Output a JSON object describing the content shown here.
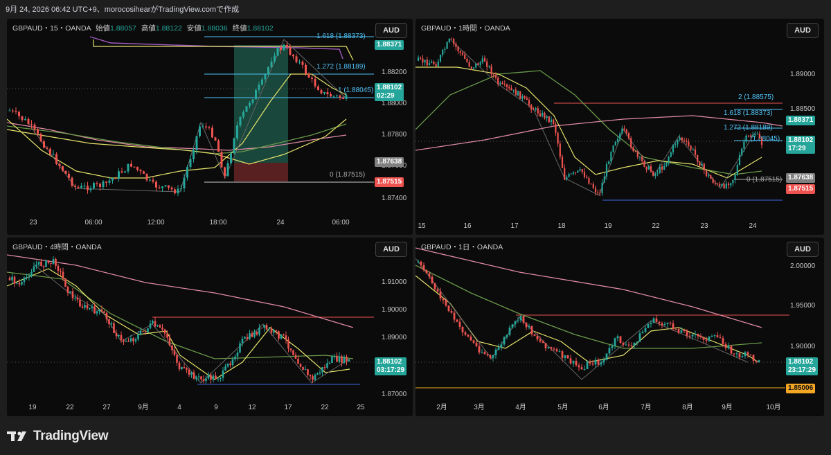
{
  "header": {
    "text": "9月 24, 2026 06:42 UTC+9、morocosihearがTradingView.comで作成"
  },
  "footer": {
    "brand": "TradingView"
  },
  "colors": {
    "up": "#26a69a",
    "down": "#ef5350",
    "bg": "#0b0b0b",
    "ma_yellow": "#e6e36a",
    "ma_green": "#6a9a4a",
    "ma_pink": "#e08aa5",
    "ma_purple": "#a05ac0"
  },
  "panels": {
    "m15": {
      "title_prefix": "GBPAUD・15・OANDA",
      "o_label": "始値",
      "o": "1.88057",
      "h_label": "高値",
      "h": "1.88122",
      "l_label": "安値",
      "l": "1.88036",
      "c_label": "終値",
      "c": "1.88102",
      "currency": "AUD",
      "price_ticks": [
        "1.88200",
        "1.88000",
        "1.87800",
        "1.87600",
        "1.87400"
      ],
      "time_ticks": [
        "23",
        "06:00",
        "12:00",
        "18:00",
        "24",
        "06:00"
      ],
      "fib": [
        "1.618 (1.88373)",
        "1.272 (1.88189)",
        "1 (1.88045)",
        "0 (1.87515)"
      ],
      "labels": {
        "a": "1.88371",
        "b": "1.88102",
        "b_sub": "02:29",
        "c": "1.87638",
        "d": "1.87515"
      }
    },
    "h1": {
      "title": "GBPAUD・1時間・OANDA",
      "currency": "AUD",
      "price_ticks": [
        "1.89000",
        "1.88500"
      ],
      "time_ticks": [
        "15",
        "16",
        "17",
        "18",
        "19",
        "22",
        "23",
        "24"
      ],
      "fib": [
        "2 (1.88575)",
        "1.618 (1.88373)",
        "1.272 (1.88189)",
        "1 (1.88045)",
        "0 (1.87515)"
      ],
      "labels": {
        "a": "1.88371",
        "b": "1.88102",
        "b_sub": "17:29",
        "c": "1.87638",
        "d": "1.87515"
      }
    },
    "h4": {
      "title": "GBPAUD・4時間・OANDA",
      "currency": "AUD",
      "price_ticks": [
        "1.91000",
        "1.90000",
        "1.89000",
        "1.87000"
      ],
      "time_ticks": [
        "19",
        "22",
        "27",
        "9月",
        "4",
        "9",
        "12",
        "17",
        "22",
        "25"
      ],
      "labels": {
        "b": "1.88102",
        "b_sub": "03:17:29"
      }
    },
    "d1": {
      "title": "GBPAUD・1日・OANDA",
      "currency": "AUD",
      "price_ticks": [
        "2.00000",
        "1.95000",
        "1.90000"
      ],
      "time_ticks": [
        "2月",
        "3月",
        "4月",
        "5月",
        "6月",
        "7月",
        "8月",
        "9月",
        "10月"
      ],
      "labels": {
        "b": "1.88102",
        "b_sub": "23:17:29",
        "e": "1.85006"
      }
    }
  }
}
